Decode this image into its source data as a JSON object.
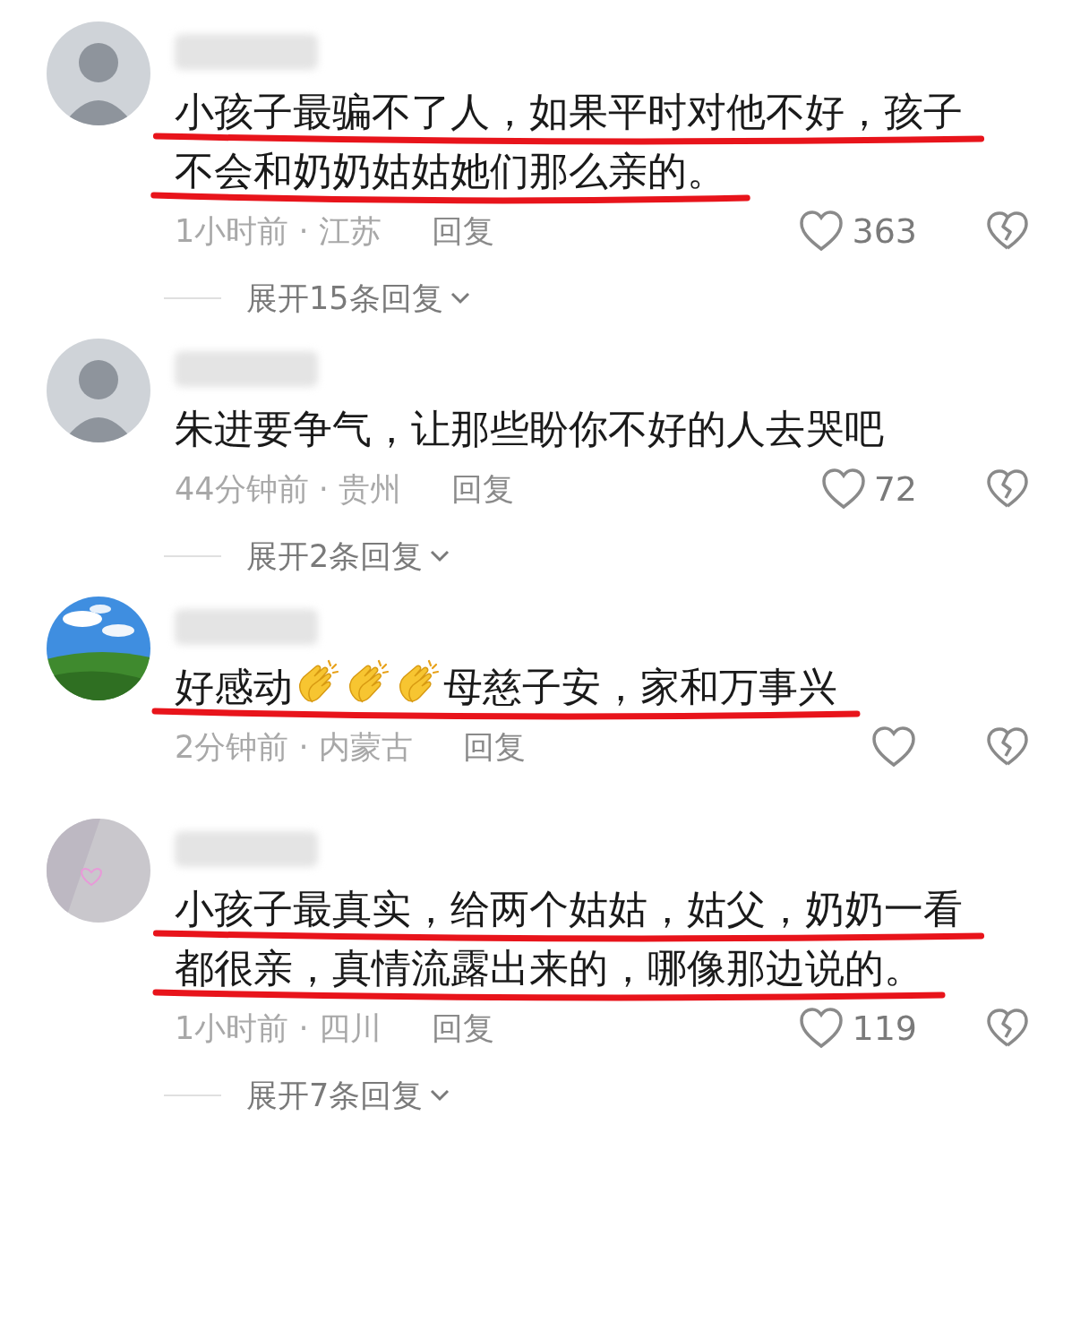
{
  "comments": [
    {
      "avatar": {
        "kind": "person"
      },
      "underlined": true,
      "lines": [
        [
          {
            "kind": "text",
            "text": "小孩子最骗不了人，如果平时对他不好，孩子"
          }
        ],
        [
          {
            "kind": "text",
            "text": "不会和奶奶姑姑她们那么亲的。"
          }
        ]
      ],
      "meta": "1小时前 · 江苏",
      "reply": "回复",
      "likes": "363",
      "expand": "展开15条回复"
    },
    {
      "avatar": {
        "kind": "person"
      },
      "underlined": false,
      "lines": [
        [
          {
            "kind": "text",
            "text": "朱进要争气，让那些盼你不好的人去哭吧"
          }
        ]
      ],
      "meta": "44分钟前 · 贵州",
      "reply": "回复",
      "likes": "72",
      "expand": "展开2条回复"
    },
    {
      "avatar": {
        "kind": "picture"
      },
      "underlined": true,
      "lines": [
        [
          {
            "kind": "text",
            "text": "好感动"
          },
          {
            "kind": "emoji"
          },
          {
            "kind": "emoji"
          },
          {
            "kind": "emoji"
          },
          {
            "kind": "text",
            "text": "母慈子安，家和万事兴"
          }
        ]
      ],
      "meta": "2分钟前 · 内蒙古",
      "reply": "回复"
    },
    {
      "avatar": {
        "kind": "pattern"
      },
      "underlined": true,
      "lines": [
        [
          {
            "kind": "text",
            "text": "小孩子最真实，给两个姑姑，姑父，奶奶一看"
          }
        ],
        [
          {
            "kind": "text",
            "text": "都很亲，真情流露出来的，哪像那边说的。"
          }
        ]
      ],
      "meta": "1小时前 · 四川",
      "reply": "回复",
      "likes": "119",
      "expand": "展开7条回复"
    }
  ]
}
